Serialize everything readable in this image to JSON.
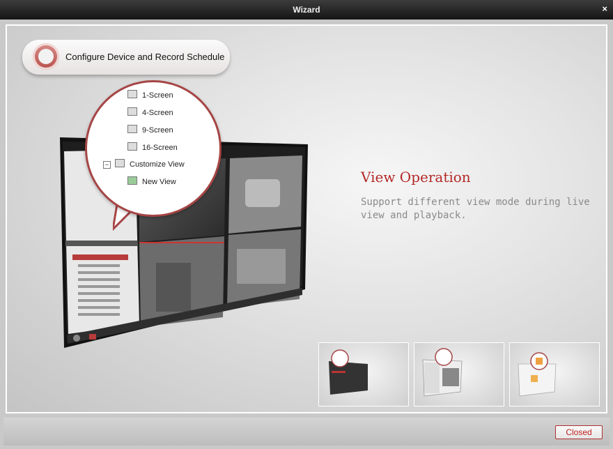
{
  "window": {
    "title": "Wizard",
    "close_glyph": "×"
  },
  "step": {
    "label": "Configure Device and Record Schedule",
    "icon": "device-record-icon"
  },
  "popup_menu": {
    "items": [
      {
        "label": "1-Screen",
        "icon": "screen-1-icon"
      },
      {
        "label": "4-Screen",
        "icon": "screen-4-icon"
      },
      {
        "label": "9-Screen",
        "icon": "screen-9-icon"
      },
      {
        "label": "16-Screen",
        "icon": "screen-16-icon"
      },
      {
        "label": "Customize View",
        "icon": "customize-view-icon",
        "toggle": "−"
      },
      {
        "label": "New View",
        "icon": "new-view-icon"
      }
    ]
  },
  "feature": {
    "title": "View Operation",
    "description": "Support different view mode during live view and playback."
  },
  "thumbnails": [
    {
      "name": "thumbnail-view-operation"
    },
    {
      "name": "thumbnail-device-list"
    },
    {
      "name": "thumbnail-record-schedule"
    }
  ],
  "footer": {
    "closed_label": "Closed"
  },
  "colors": {
    "accent": "#b42828",
    "bubble_border": "#a64545",
    "description": "#8a8a8a"
  }
}
